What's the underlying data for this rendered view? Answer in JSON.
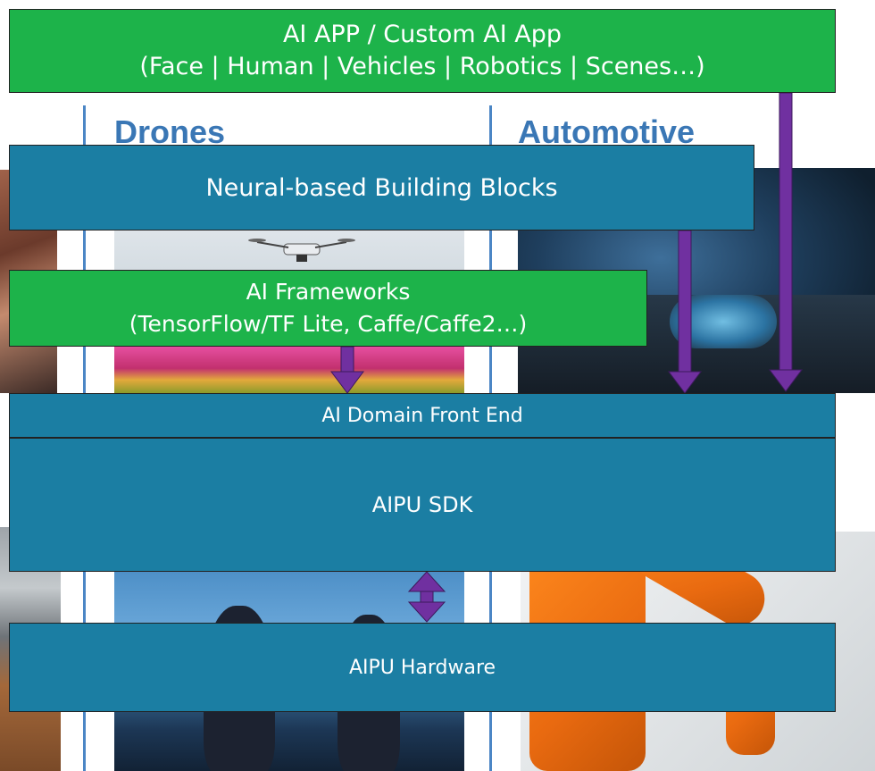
{
  "app_layer": {
    "line1": "AI APP / Custom AI App",
    "line2": "(Face | Human | Vehicles | Robotics | Scenes…)"
  },
  "columns": {
    "left_title": "Drones",
    "right_title": "Automotive"
  },
  "building_blocks": {
    "label": "Neural-based Building Blocks"
  },
  "frameworks": {
    "line1": "AI Frameworks",
    "line2": "(TensorFlow/TF Lite, Caffe/Caffe2…)"
  },
  "front_end": {
    "label": "AI Domain Front End"
  },
  "sdk": {
    "label": "AIPU SDK"
  },
  "hardware": {
    "label": "AIPU  Hardware"
  },
  "colors": {
    "green": "#1db34a",
    "teal": "#1b7ea3",
    "arrow": "#7030a0",
    "title_blue": "#3a77b5"
  }
}
